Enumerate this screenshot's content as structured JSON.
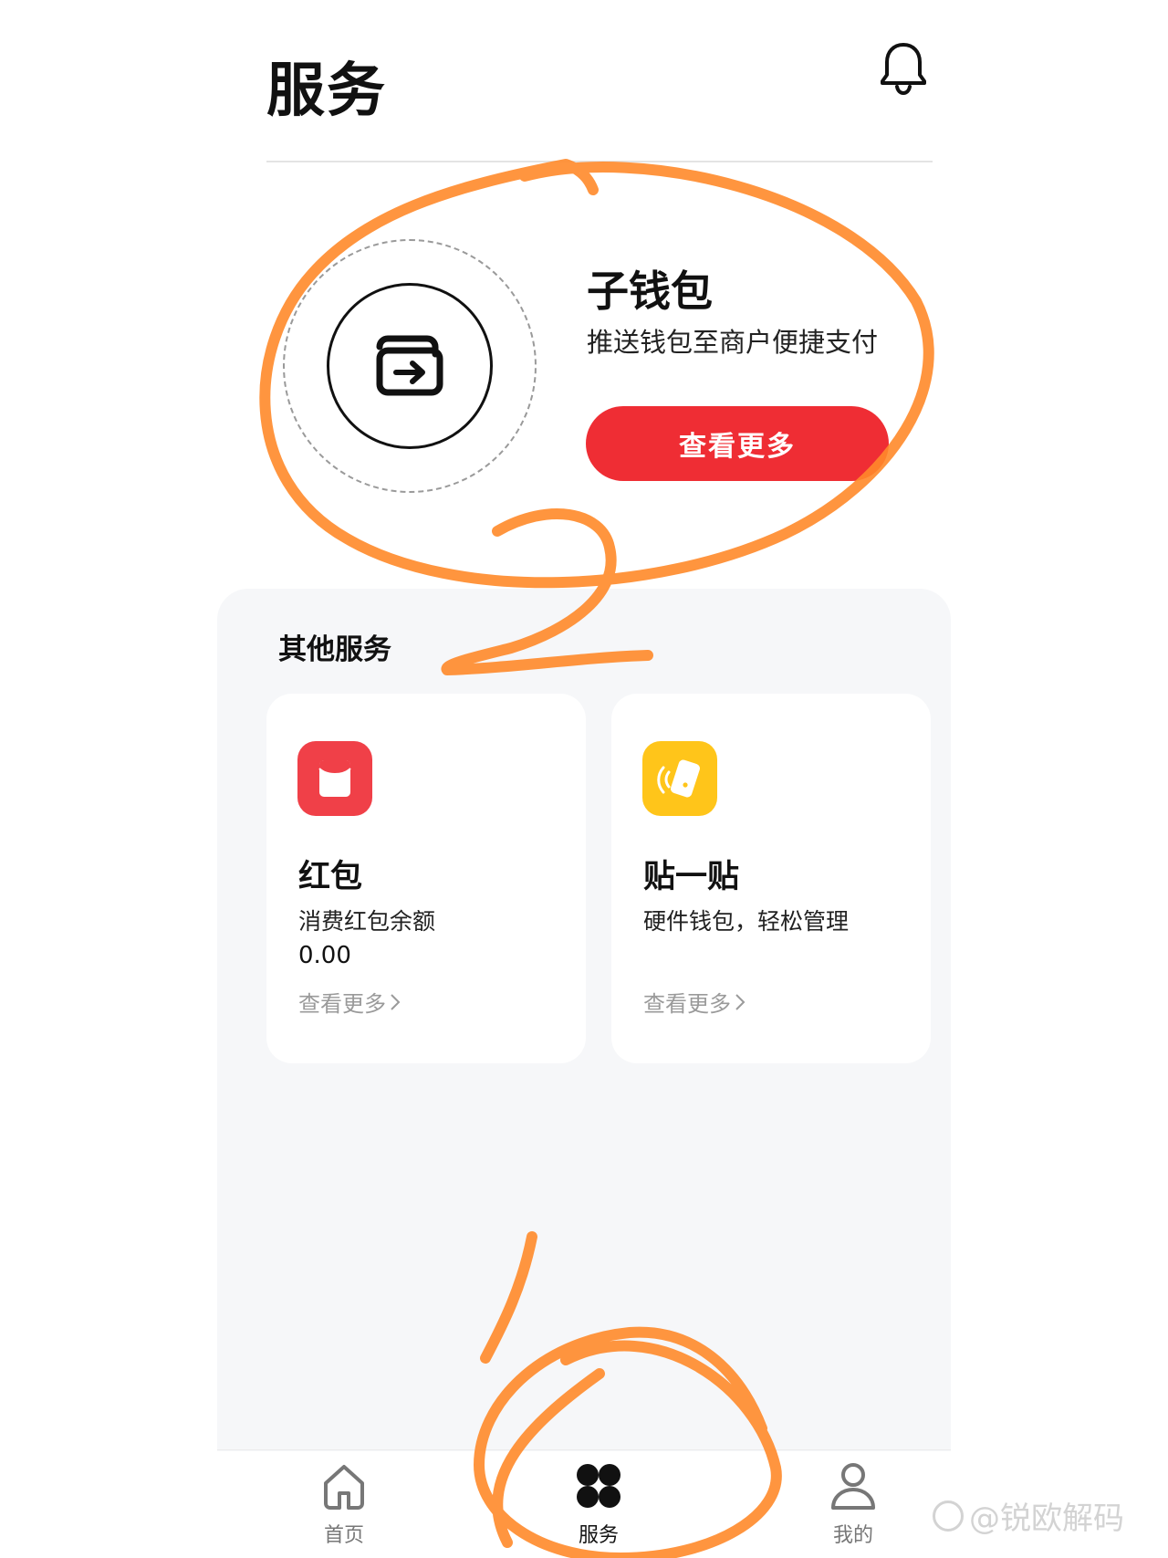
{
  "header": {
    "title": "服务",
    "bell_icon": "bell-icon"
  },
  "wallet_card": {
    "icon": "wallet-transfer-icon",
    "title": "子钱包",
    "description": "推送钱包至商户便捷支付",
    "button_label": "查看更多",
    "button_color": "#ef2d34"
  },
  "other_services": {
    "title": "其他服务",
    "cards": [
      {
        "icon": "red-envelope-icon",
        "icon_color": "#f04048",
        "title": "红包",
        "description": "消费红包余额",
        "value": "0.00",
        "more_label": "查看更多"
      },
      {
        "icon": "nfc-tap-icon",
        "icon_color": "#ffc51a",
        "title": "贴一贴",
        "description": "硬件钱包，轻松管理",
        "more_label": "查看更多"
      }
    ]
  },
  "tabbar": {
    "tabs": [
      {
        "icon": "home-icon",
        "label": "首页",
        "active": false
      },
      {
        "icon": "service-grid-icon",
        "label": "服务",
        "active": true
      },
      {
        "icon": "user-icon",
        "label": "我的",
        "active": false
      }
    ]
  },
  "annotations": {
    "color": "#ff8a2a",
    "marks": [
      "2",
      "1"
    ]
  },
  "watermark": {
    "text": "@锐欧解码"
  }
}
